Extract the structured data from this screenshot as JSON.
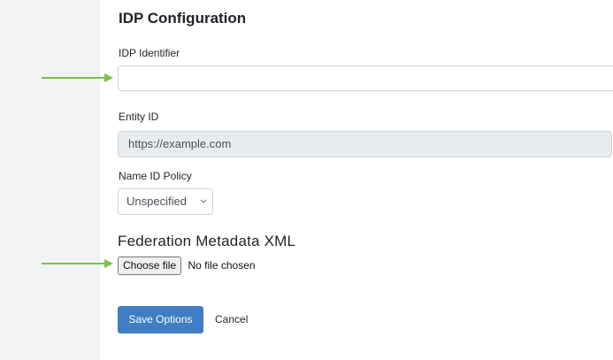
{
  "section_title": "IDP Configuration",
  "idp_identifier": {
    "label": "IDP Identifier",
    "value": ""
  },
  "entity_id": {
    "label": "Entity ID",
    "value": "https://example.com"
  },
  "name_id_policy": {
    "label": "Name ID Policy",
    "selected": "Unspecified"
  },
  "metadata": {
    "heading": "Federation Metadata XML",
    "choose_label": "Choose file",
    "status": "No file chosen"
  },
  "actions": {
    "save_label": "Save Options",
    "cancel_label": "Cancel"
  },
  "colors": {
    "arrow": "#7bbf4a",
    "primary": "#3f7ec4",
    "sidebar": "#f1f3f5"
  }
}
